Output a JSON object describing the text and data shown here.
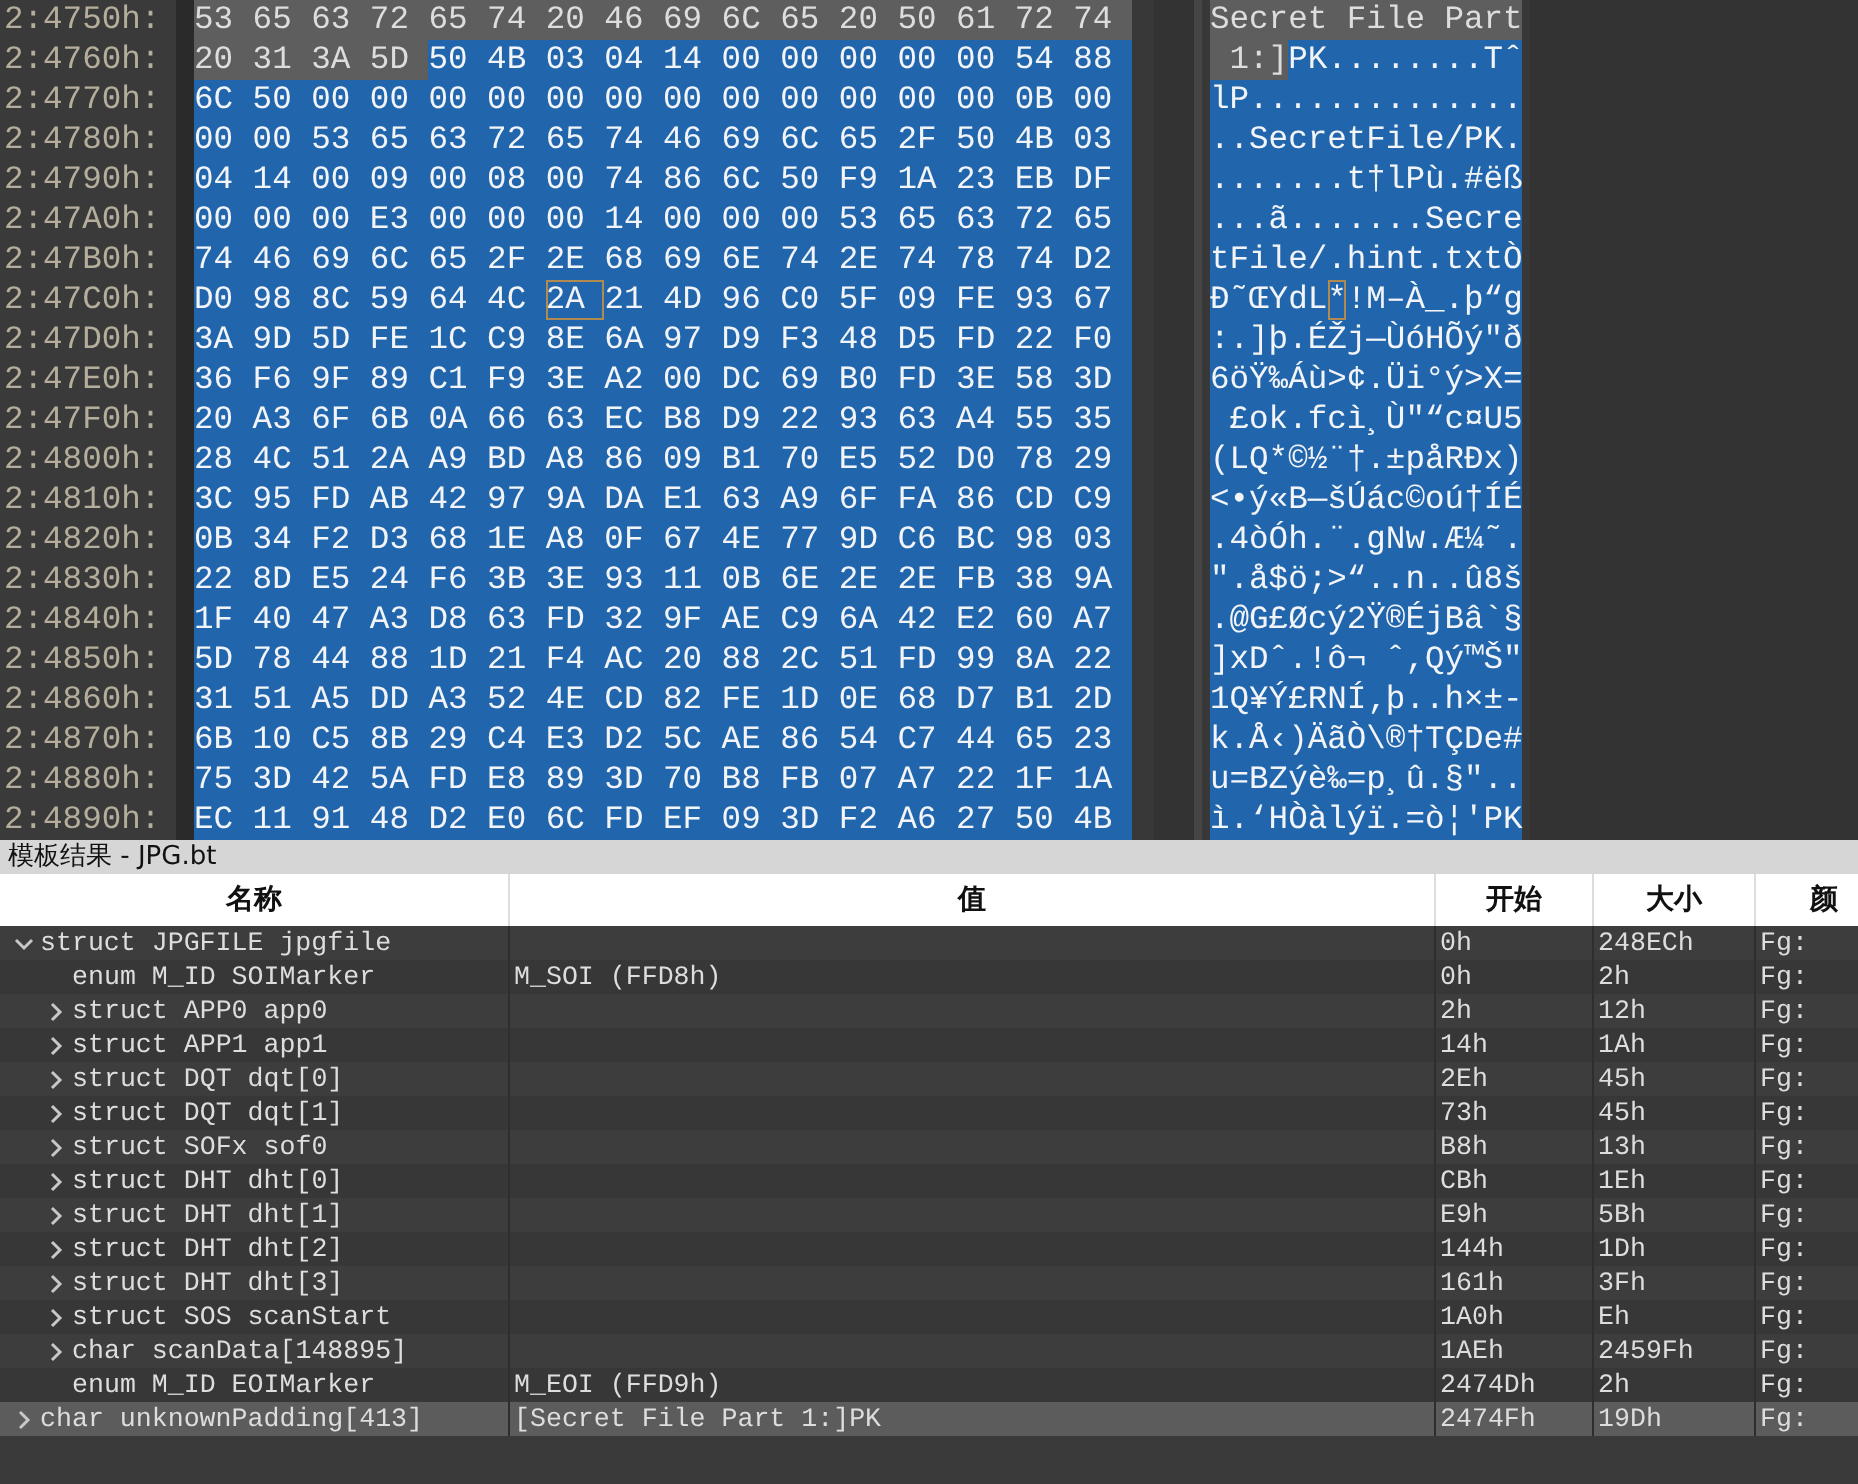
{
  "hex_editor": {
    "rows": [
      {
        "address": "2:4750h:",
        "segments": [
          {
            "bytes": "53 65 63 72 65 74 20 46 69 6C 65 20 50 61 72 74",
            "text": "Secret File Part",
            "selected": false,
            "cursor": false
          }
        ]
      },
      {
        "address": "2:4760h:",
        "segments": [
          {
            "bytes": "20 31 3A 5D",
            "text": " 1:]",
            "selected": false,
            "cursor": false
          },
          {
            "bytes": "50 4B 03 04 14 00 00 00 00 00 54 88",
            "text": "PK........Tˆ",
            "selected": true,
            "cursor": false
          }
        ]
      },
      {
        "address": "2:4770h:",
        "segments": [
          {
            "bytes": "6C 50 00 00 00 00 00 00 00 00 00 00 00 00 0B 00",
            "text": "lP..............",
            "selected": true,
            "cursor": false
          }
        ]
      },
      {
        "address": "2:4780h:",
        "segments": [
          {
            "bytes": "00 00 53 65 63 72 65 74 46 69 6C 65 2F 50 4B 03",
            "text": "..SecretFile/PK.",
            "selected": true,
            "cursor": false
          }
        ]
      },
      {
        "address": "2:4790h:",
        "segments": [
          {
            "bytes": "04 14 00 09 00 08 00 74 86 6C 50 F9 1A 23 EB DF",
            "text": ".......t†lPù.#ëß",
            "selected": true,
            "cursor": false
          }
        ]
      },
      {
        "address": "2:47A0h:",
        "segments": [
          {
            "bytes": "00 00 00 E3 00 00 00 14 00 00 00 53 65 63 72 65",
            "text": "...ã.......Secre",
            "selected": true,
            "cursor": false
          }
        ]
      },
      {
        "address": "2:47B0h:",
        "segments": [
          {
            "bytes": "74 46 69 6C 65 2F 2E 68 69 6E 74 2E 74 78 74 D2",
            "text": "tFile/.hint.txtÒ",
            "selected": true,
            "cursor": false
          }
        ]
      },
      {
        "address": "2:47C0h:",
        "segments": [
          {
            "bytes": "D0 98 8C 59 64 4C",
            "text": "Ð˜ŒYdL",
            "selected": true,
            "cursor": false
          },
          {
            "bytes": "2A",
            "text": "*",
            "selected": true,
            "cursor": true
          },
          {
            "bytes": "21 4D 96 C0 5F 09 FE 93 67",
            "text": "!M–À_.þ“g",
            "selected": true,
            "cursor": false
          }
        ]
      },
      {
        "address": "2:47D0h:",
        "segments": [
          {
            "bytes": "3A 9D 5D FE 1C C9 8E 6A 97 D9 F3 48 D5 FD 22 F0",
            "text": ":.]þ.ÉŽj—ÙóHÕý\"ð",
            "selected": true,
            "cursor": false
          }
        ]
      },
      {
        "address": "2:47E0h:",
        "segments": [
          {
            "bytes": "36 F6 9F 89 C1 F9 3E A2 00 DC 69 B0 FD 3E 58 3D",
            "text": "6öŸ‰Áù>¢.Üi°ý>X=",
            "selected": true,
            "cursor": false
          }
        ]
      },
      {
        "address": "2:47F0h:",
        "segments": [
          {
            "bytes": "20 A3 6F 6B 0A 66 63 EC B8 D9 22 93 63 A4 55 35",
            "text": " £ok.fcì¸Ù\"“c¤U5",
            "selected": true,
            "cursor": false
          }
        ]
      },
      {
        "address": "2:4800h:",
        "segments": [
          {
            "bytes": "28 4C 51 2A A9 BD A8 86 09 B1 70 E5 52 D0 78 29",
            "text": "(LQ*©½¨†.±påRÐx)",
            "selected": true,
            "cursor": false
          }
        ]
      },
      {
        "address": "2:4810h:",
        "segments": [
          {
            "bytes": "3C 95 FD AB 42 97 9A DA E1 63 A9 6F FA 86 CD C9",
            "text": "<•ý«B—šÚác©oú†ÍÉ",
            "selected": true,
            "cursor": false
          }
        ]
      },
      {
        "address": "2:4820h:",
        "segments": [
          {
            "bytes": "0B 34 F2 D3 68 1E A8 0F 67 4E 77 9D C6 BC 98 03",
            "text": ".4òÓh.¨.gNw.Æ¼˜.",
            "selected": true,
            "cursor": false
          }
        ]
      },
      {
        "address": "2:4830h:",
        "segments": [
          {
            "bytes": "22 8D E5 24 F6 3B 3E 93 11 0B 6E 2E 2E FB 38 9A",
            "text": "\".å$ö;>“..n..û8š",
            "selected": true,
            "cursor": false
          }
        ]
      },
      {
        "address": "2:4840h:",
        "segments": [
          {
            "bytes": "1F 40 47 A3 D8 63 FD 32 9F AE C9 6A 42 E2 60 A7",
            "text": ".@G£Øcý2Ÿ®ÉjBâ`§",
            "selected": true,
            "cursor": false
          }
        ]
      },
      {
        "address": "2:4850h:",
        "segments": [
          {
            "bytes": "5D 78 44 88 1D 21 F4 AC 20 88 2C 51 FD 99 8A 22",
            "text": "]xDˆ.!ô¬ ˆ,Qý™Š\"",
            "selected": true,
            "cursor": false
          }
        ]
      },
      {
        "address": "2:4860h:",
        "segments": [
          {
            "bytes": "31 51 A5 DD A3 52 4E CD 82 FE 1D 0E 68 D7 B1 2D",
            "text": "1Q¥Ý£RNÍ‚þ..h×±-",
            "selected": true,
            "cursor": false
          }
        ]
      },
      {
        "address": "2:4870h:",
        "segments": [
          {
            "bytes": "6B 10 C5 8B 29 C4 E3 D2 5C AE 86 54 C7 44 65 23",
            "text": "k.Å‹)ÄãÒ\\®†TÇDe#",
            "selected": true,
            "cursor": false
          }
        ]
      },
      {
        "address": "2:4880h:",
        "segments": [
          {
            "bytes": "75 3D 42 5A FD E8 89 3D 70 B8 FB 07 A7 22 1F 1A",
            "text": "u=BZýè‰=p¸û.§\"..",
            "selected": true,
            "cursor": false
          }
        ]
      },
      {
        "address": "2:4890h:",
        "segments": [
          {
            "bytes": "EC 11 91 48 D2 E0 6C FD EF 09 3D F2 A6 27 50 4B",
            "text": "ì.‘HÒàlýï.=ò¦'PK",
            "selected": true,
            "cursor": false
          }
        ]
      }
    ]
  },
  "template_results": {
    "title": "模板结果 - JPG.bt",
    "columns": [
      "名称",
      "值",
      "开始",
      "大小",
      "颜"
    ],
    "rows": [
      {
        "name": "struct JPGFILE jpgfile",
        "start": "0h",
        "size": "248ECh",
        "column_5": "Fg:",
        "kind": "group",
        "expanded": true,
        "selected": false,
        "children": [
          {
            "name": "enum M_ID SOIMarker",
            "value": "M_SOI (FFD8h)",
            "start": "0h",
            "size": "2h",
            "column_5": "Fg:",
            "kind": "field",
            "selected": false
          },
          {
            "name": "struct APP0 app0",
            "start": "2h",
            "size": "12h",
            "column_5": "Fg:",
            "kind": "group",
            "expanded": false,
            "selected": false
          },
          {
            "name": "struct APP1 app1",
            "start": "14h",
            "size": "1Ah",
            "column_5": "Fg:",
            "kind": "group",
            "expanded": false,
            "selected": false
          },
          {
            "name": "struct DQT dqt[0]",
            "start": "2Eh",
            "size": "45h",
            "column_5": "Fg:",
            "kind": "group",
            "expanded": false,
            "selected": false
          },
          {
            "name": "struct DQT dqt[1]",
            "start": "73h",
            "size": "45h",
            "column_5": "Fg:",
            "kind": "group",
            "expanded": false,
            "selected": false
          },
          {
            "name": "struct SOFx sof0",
            "start": "B8h",
            "size": "13h",
            "column_5": "Fg:",
            "kind": "group",
            "expanded": false,
            "selected": false
          },
          {
            "name": "struct DHT dht[0]",
            "start": "CBh",
            "size": "1Eh",
            "column_5": "Fg:",
            "kind": "group",
            "expanded": false,
            "selected": false
          },
          {
            "name": "struct DHT dht[1]",
            "start": "E9h",
            "size": "5Bh",
            "column_5": "Fg:",
            "kind": "group",
            "expanded": false,
            "selected": false
          },
          {
            "name": "struct DHT dht[2]",
            "start": "144h",
            "size": "1Dh",
            "column_5": "Fg:",
            "kind": "group",
            "expanded": false,
            "selected": false
          },
          {
            "name": "struct DHT dht[3]",
            "start": "161h",
            "size": "3Fh",
            "column_5": "Fg:",
            "kind": "group",
            "expanded": false,
            "selected": false
          },
          {
            "name": "struct SOS scanStart",
            "start": "1A0h",
            "size": "Eh",
            "column_5": "Fg:",
            "kind": "group",
            "expanded": false,
            "selected": false
          },
          {
            "name": "char scanData[148895]",
            "start": "1AEh",
            "size": "2459Fh",
            "column_5": "Fg:",
            "kind": "group",
            "expanded": false,
            "selected": false
          },
          {
            "name": "enum M_ID EOIMarker",
            "value": "M_EOI (FFD9h)",
            "start": "2474Dh",
            "size": "2h",
            "column_5": "Fg:",
            "kind": "field",
            "selected": false
          }
        ]
      },
      {
        "name": "char unknownPadding[413]",
        "value": "[Secret File Part 1:]PK",
        "start": "2474Fh",
        "size": "19Dh",
        "column_5": "Fg:",
        "kind": "group",
        "expanded": false,
        "selected": true
      }
    ]
  }
}
